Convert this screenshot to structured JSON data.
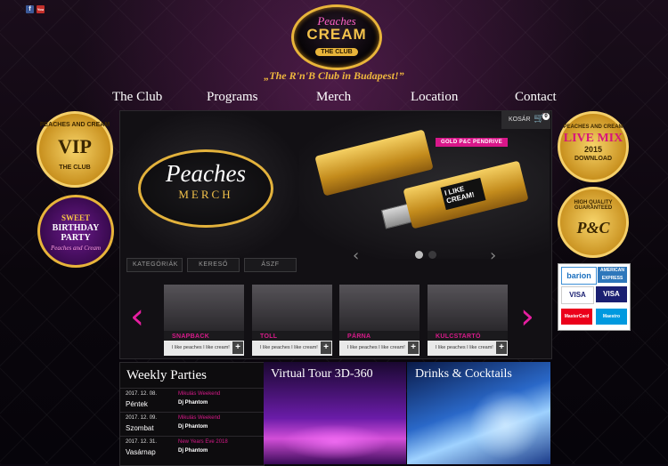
{
  "social": {
    "facebook": "f",
    "youtube": "You"
  },
  "logo": {
    "line1": "Peaches",
    "line2": "CREAM",
    "line3": "THE CLUB"
  },
  "tagline": "„The R'n'B Club in Budapest!”",
  "nav": [
    "The Club",
    "Programs",
    "Merch",
    "Location",
    "Contact"
  ],
  "badges": {
    "vip": {
      "top": "PEACHES AND CREAM",
      "main": "VIP",
      "bottom": "THE CLUB"
    },
    "birthday": {
      "line1": "SWEET",
      "line2": "BIRTHDAY PARTY",
      "line3": "Peaches and Cream"
    },
    "livemix": {
      "top": "PEACHES AND CREAM",
      "main": "LIVE MIX",
      "year": "2015",
      "bottom": "DOWNLOAD"
    },
    "quality": {
      "top": "HIGH QUALITY GUARANTEED",
      "main": "P&C"
    }
  },
  "payment": {
    "barion": "barion",
    "amex": "AMERICAN EXPRESS",
    "visa1": "VISA",
    "visa2": "VISA",
    "mastercard": "MasterCard",
    "maestro": "Maestro"
  },
  "merch": {
    "logo_title": "Peaches",
    "logo_sub": "MERCH",
    "product_tag": "GOLD P&C PENDRIVE",
    "product_print": "I LIKE CREAM!",
    "cart_label": "KOSÁR",
    "cart_count": "0",
    "tabs": [
      "KATEGÓRIÁK",
      "KERESŐ",
      "ÁSZF"
    ],
    "prev_arrow": "‹",
    "next_arrow": "›",
    "carousel_prev": "‹",
    "carousel_next": "›",
    "products": [
      {
        "name": "SNAPBACK",
        "desc": "I like peaches I like cream!",
        "add": "+"
      },
      {
        "name": "TOLL",
        "desc": "I like peaches I like cream!",
        "add": "+"
      },
      {
        "name": "PÁRNA",
        "desc": "I like peaches I like cream!",
        "add": "+"
      },
      {
        "name": "KULCSTARTÓ",
        "desc": "I like peaches I like cream!",
        "add": "+"
      }
    ]
  },
  "weekly": {
    "title": "Weekly Parties",
    "events": [
      {
        "date": "2017. 12. 08.",
        "day": "Péntek",
        "name": "Mikulás Weekend",
        "dj": "Dj Phantom"
      },
      {
        "date": "2017. 12. 09.",
        "day": "Szombat",
        "name": "Mikulás Weekend",
        "dj": "Dj Phantom"
      },
      {
        "date": "2017. 12. 31.",
        "day": "Vasárnap",
        "name": "New Years Eve 2018",
        "dj": "Dj Phantom"
      }
    ]
  },
  "tour": {
    "title": "Virtual Tour 3D-360"
  },
  "drinks": {
    "title": "Drinks & Cocktails"
  },
  "colors": {
    "accent": "#e61ea0",
    "gold": "#e8b43a"
  }
}
